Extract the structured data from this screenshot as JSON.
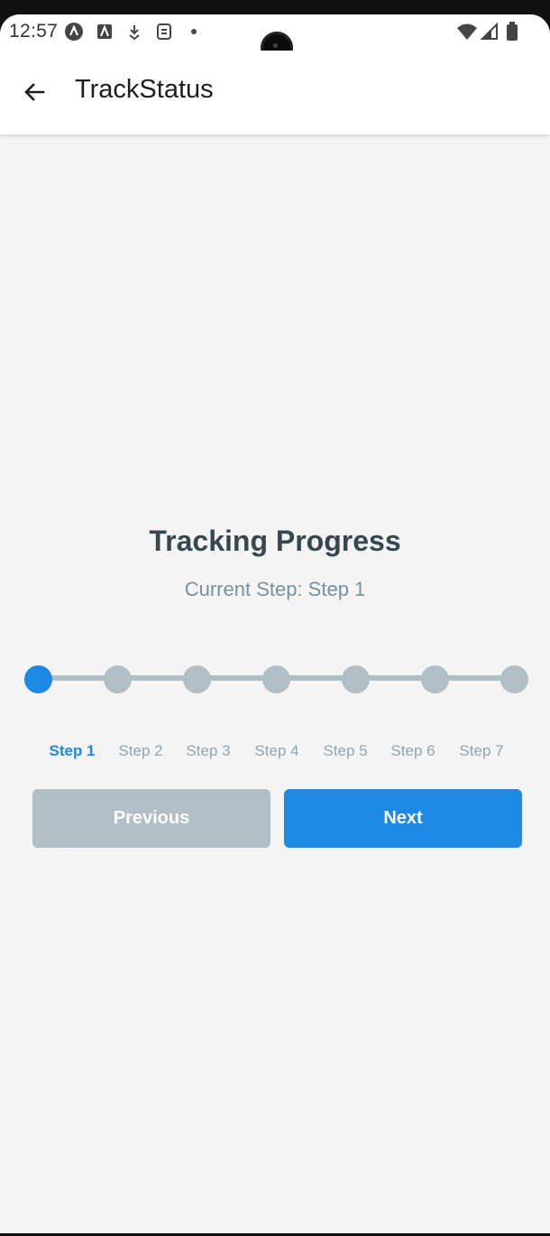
{
  "status_bar": {
    "time": "12:57",
    "notification_icons": [
      "app-a-icon",
      "accessibility-icon",
      "download-icon",
      "shield-app-icon",
      "more-dot-icon"
    ],
    "right_icons": [
      "wifi-icon",
      "cellular-signal-icon",
      "battery-icon"
    ]
  },
  "app_bar": {
    "title": "TrackStatus",
    "back_icon": "arrow-back-icon"
  },
  "main": {
    "headline": "Tracking Progress",
    "current_step_text": "Current Step: Step 1",
    "current_step_index": 1,
    "steps": [
      "Step 1",
      "Step 2",
      "Step 3",
      "Step 4",
      "Step 5",
      "Step 6",
      "Step 7"
    ],
    "previous_label": "Previous",
    "next_label": "Next"
  },
  "colors": {
    "accent": "#1e88e5",
    "inactive": "#b0bec5",
    "title_text": "#37474f",
    "subtitle_text": "#78909c",
    "background": "#f4f4f4"
  }
}
